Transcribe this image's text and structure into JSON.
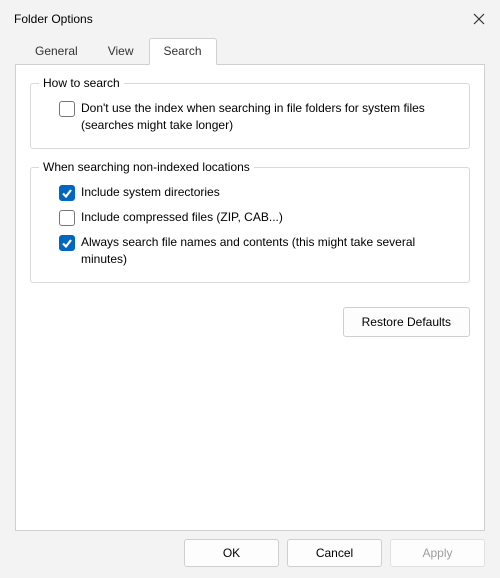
{
  "window": {
    "title": "Folder Options"
  },
  "tabs": {
    "general": "General",
    "view": "View",
    "search": "Search"
  },
  "group1": {
    "title": "How to search",
    "option1": "Don't use the index when searching in file folders for system files (searches might take longer)"
  },
  "group2": {
    "title": "When searching non-indexed locations",
    "option1": "Include system directories",
    "option2": "Include compressed files (ZIP, CAB...)",
    "option3": "Always search file names and contents (this might take several minutes)"
  },
  "buttons": {
    "restore": "Restore Defaults",
    "ok": "OK",
    "cancel": "Cancel",
    "apply": "Apply"
  }
}
